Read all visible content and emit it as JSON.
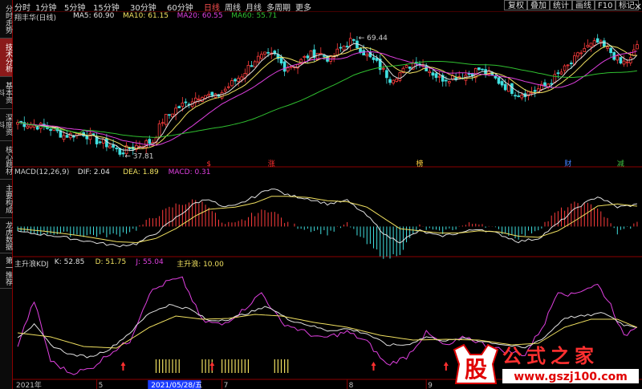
{
  "sidebar": {
    "items": [
      {
        "label": "分时走势",
        "active": false
      },
      {
        "label": "技术分析",
        "active": true
      },
      {
        "label": "基本资料",
        "active": false
      },
      {
        "label": "深度资料",
        "active": false
      },
      {
        "label": "核心题材",
        "active": false
      },
      {
        "label": "主要构成",
        "active": false
      },
      {
        "label": "龙虎数据",
        "active": false
      },
      {
        "label": "第一推荐",
        "active": false
      }
    ]
  },
  "topbar": {
    "periods": [
      {
        "label": "分时",
        "active": false
      },
      {
        "label": "1分钟",
        "active": false
      },
      {
        "label": "5分钟",
        "active": false
      },
      {
        "label": "15分钟",
        "active": false
      },
      {
        "label": "30分钟",
        "active": false
      },
      {
        "label": "60分钟",
        "active": false
      },
      {
        "label": "日线",
        "active": true
      },
      {
        "label": "周线",
        "active": false
      },
      {
        "label": "月线",
        "active": false
      },
      {
        "label": "多周期",
        "active": false
      },
      {
        "label": "更多",
        "active": false
      }
    ],
    "buttons": [
      "复权",
      "叠加",
      "统计",
      "画线",
      "F10",
      "标记"
    ],
    "close_symbol": "×"
  },
  "main_panel": {
    "stock_name": "翔丰华(日线)",
    "ma_legend": [
      {
        "label": "MA5: 60.90",
        "color": "#e0e0e0"
      },
      {
        "label": "MA10: 61.15",
        "color": "#f0e060"
      },
      {
        "label": "MA20: 60.55",
        "color": "#e040e0"
      },
      {
        "label": "MA60: 55.71",
        "color": "#30c030"
      }
    ],
    "high_label": "69.44",
    "low_label": "37.81",
    "markers": [
      {
        "text": "$",
        "color": "#ff3030",
        "idx": 58
      },
      {
        "text": "涨",
        "color": "#ff3030",
        "idx": 77
      },
      {
        "text": "榜",
        "color": "#ffd040",
        "idx": 122
      },
      {
        "text": "财",
        "color": "#4080ff",
        "idx": 167
      },
      {
        "text": "减",
        "color": "#40c040",
        "idx": 183
      }
    ]
  },
  "macd_panel": {
    "legend": [
      {
        "label": "MACD(12,26,9)",
        "color": "#d0d0d0"
      },
      {
        "label": "DIF: 2.04",
        "color": "#e0e0e0"
      },
      {
        "label": "DEA: 1.89",
        "color": "#f0e060"
      },
      {
        "label": "MACD: 0.31",
        "color": "#e040e0"
      }
    ]
  },
  "kdj_panel": {
    "legend": [
      {
        "label": "主升浪KDJ",
        "color": "#d0d0d0"
      },
      {
        "label": "K: 52.85",
        "color": "#e0e0e0"
      },
      {
        "label": "D: 51.75",
        "color": "#f0e060"
      },
      {
        "label": "J: 55.04",
        "color": "#e040e0"
      },
      {
        "label": "主升浪: 10.00",
        "color": "#f0e060"
      }
    ]
  },
  "date_axis": {
    "labels": [
      {
        "text": "2021年",
        "idx": 0,
        "highlight": false
      },
      {
        "text": "5",
        "idx": 24,
        "highlight": false
      },
      {
        "text": "2021/05/28/五",
        "idx": 40,
        "highlight": true
      },
      {
        "text": "7",
        "idx": 62,
        "highlight": false
      },
      {
        "text": "8",
        "idx": 100,
        "highlight": false
      },
      {
        "text": "9",
        "idx": 124,
        "highlight": false
      }
    ]
  },
  "logo": {
    "badge": "股",
    "name": "公式之家",
    "url": "www.gszj100.com"
  },
  "colors": {
    "up": "#ff3c3c",
    "down": "#40e0e0",
    "ma5": "#e0e0e0",
    "ma10": "#f0e060",
    "ma20": "#e040e0",
    "ma60": "#30c030",
    "grid": "#8b0000"
  },
  "chart_data": [
    {
      "type": "candlestick",
      "title": "翔丰华(日线)",
      "series": [
        {
          "name": "MA5",
          "value": 60.9
        },
        {
          "name": "MA10",
          "value": 61.15
        },
        {
          "name": "MA20",
          "value": 60.55
        },
        {
          "name": "MA60",
          "value": 55.71
        }
      ],
      "ohlc_points": [
        {
          "i": 0,
          "c": 46.5
        },
        {
          "i": 6,
          "c": 45.6
        },
        {
          "i": 10,
          "c": 44.8
        },
        {
          "i": 14,
          "c": 43.0
        },
        {
          "i": 20,
          "c": 43.6
        },
        {
          "i": 24,
          "c": 41.6
        },
        {
          "i": 28,
          "c": 40.4
        },
        {
          "i": 31,
          "c": 38.5
        },
        {
          "i": 36,
          "c": 40.3
        },
        {
          "i": 41,
          "c": 41.5
        },
        {
          "i": 44,
          "c": 47.0
        },
        {
          "i": 48,
          "c": 50.0
        },
        {
          "i": 52,
          "c": 52.0
        },
        {
          "i": 56,
          "c": 54.0
        },
        {
          "i": 60,
          "c": 53.0
        },
        {
          "i": 64,
          "c": 56.0
        },
        {
          "i": 68,
          "c": 59.0
        },
        {
          "i": 70,
          "c": 61.0
        },
        {
          "i": 72,
          "c": 63.0
        },
        {
          "i": 75,
          "c": 64.0
        },
        {
          "i": 78,
          "c": 64.0
        },
        {
          "i": 81,
          "c": 61.0
        },
        {
          "i": 85,
          "c": 62.0
        },
        {
          "i": 88,
          "c": 64.0
        },
        {
          "i": 91,
          "c": 65.0
        },
        {
          "i": 95,
          "c": 63.0
        },
        {
          "i": 98,
          "c": 66.0
        },
        {
          "i": 101,
          "c": 68.0
        },
        {
          "i": 104,
          "c": 66.0
        },
        {
          "i": 106,
          "c": 64.0
        },
        {
          "i": 109,
          "c": 62.0
        },
        {
          "i": 113,
          "c": 58.0
        },
        {
          "i": 117,
          "c": 60.0
        },
        {
          "i": 121,
          "c": 63.0
        },
        {
          "i": 124,
          "c": 61.0
        },
        {
          "i": 128,
          "c": 58.0
        },
        {
          "i": 132,
          "c": 58.5
        },
        {
          "i": 136,
          "c": 59.0
        },
        {
          "i": 140,
          "c": 60.5
        },
        {
          "i": 144,
          "c": 58.5
        },
        {
          "i": 148,
          "c": 56.0
        },
        {
          "i": 152,
          "c": 54.0
        },
        {
          "i": 156,
          "c": 54.5
        },
        {
          "i": 160,
          "c": 56.0
        },
        {
          "i": 164,
          "c": 59.0
        },
        {
          "i": 168,
          "c": 62.0
        },
        {
          "i": 172,
          "c": 66.0
        },
        {
          "i": 176,
          "c": 67.5
        },
        {
          "i": 180,
          "c": 65.0
        },
        {
          "i": 183,
          "c": 62.0
        },
        {
          "i": 186,
          "c": 63.0
        },
        {
          "i": 188,
          "c": 67.0
        }
      ],
      "n_bars": 189,
      "high": 69.44,
      "low": 37.81,
      "ylim": [
        36,
        72
      ]
    },
    {
      "type": "bar",
      "title": "MACD(12,26,9)",
      "series": [
        {
          "name": "DIF",
          "value": 2.04
        },
        {
          "name": "DEA",
          "value": 1.89
        },
        {
          "name": "MACD",
          "value": 0.31
        }
      ],
      "dif_points": [
        {
          "i": 0,
          "v": -0.5
        },
        {
          "i": 10,
          "v": -0.8
        },
        {
          "i": 20,
          "v": -1.3
        },
        {
          "i": 30,
          "v": -1.8
        },
        {
          "i": 36,
          "v": -1.6
        },
        {
          "i": 42,
          "v": -0.6
        },
        {
          "i": 48,
          "v": 0.8
        },
        {
          "i": 54,
          "v": 2.2
        },
        {
          "i": 58,
          "v": 2.6
        },
        {
          "i": 62,
          "v": 1.8
        },
        {
          "i": 66,
          "v": 1.9
        },
        {
          "i": 72,
          "v": 2.8
        },
        {
          "i": 77,
          "v": 3.6
        },
        {
          "i": 82,
          "v": 2.9
        },
        {
          "i": 88,
          "v": 2.6
        },
        {
          "i": 94,
          "v": 2.1
        },
        {
          "i": 100,
          "v": 2.4
        },
        {
          "i": 106,
          "v": 1.0
        },
        {
          "i": 112,
          "v": -0.9
        },
        {
          "i": 116,
          "v": -1.4
        },
        {
          "i": 122,
          "v": -0.4
        },
        {
          "i": 128,
          "v": -0.9
        },
        {
          "i": 134,
          "v": -0.6
        },
        {
          "i": 140,
          "v": -0.2
        },
        {
          "i": 146,
          "v": -0.7
        },
        {
          "i": 152,
          "v": -1.4
        },
        {
          "i": 158,
          "v": -1.1
        },
        {
          "i": 164,
          "v": 0.3
        },
        {
          "i": 170,
          "v": 1.8
        },
        {
          "i": 176,
          "v": 2.8
        },
        {
          "i": 182,
          "v": 1.8
        },
        {
          "i": 188,
          "v": 2.04
        }
      ],
      "dea_points": [
        {
          "i": 0,
          "v": -0.2
        },
        {
          "i": 10,
          "v": -0.5
        },
        {
          "i": 20,
          "v": -0.9
        },
        {
          "i": 30,
          "v": -1.4
        },
        {
          "i": 36,
          "v": -1.5
        },
        {
          "i": 42,
          "v": -1.1
        },
        {
          "i": 48,
          "v": -0.2
        },
        {
          "i": 54,
          "v": 1.0
        },
        {
          "i": 58,
          "v": 1.6
        },
        {
          "i": 62,
          "v": 1.7
        },
        {
          "i": 66,
          "v": 1.8
        },
        {
          "i": 72,
          "v": 2.2
        },
        {
          "i": 77,
          "v": 2.8
        },
        {
          "i": 82,
          "v": 2.8
        },
        {
          "i": 88,
          "v": 2.7
        },
        {
          "i": 94,
          "v": 2.4
        },
        {
          "i": 100,
          "v": 2.3
        },
        {
          "i": 106,
          "v": 1.8
        },
        {
          "i": 112,
          "v": 0.6
        },
        {
          "i": 116,
          "v": -0.2
        },
        {
          "i": 122,
          "v": -0.4
        },
        {
          "i": 128,
          "v": -0.6
        },
        {
          "i": 134,
          "v": -0.6
        },
        {
          "i": 140,
          "v": -0.4
        },
        {
          "i": 146,
          "v": -0.5
        },
        {
          "i": 152,
          "v": -0.9
        },
        {
          "i": 158,
          "v": -1.0
        },
        {
          "i": 164,
          "v": -0.4
        },
        {
          "i": 170,
          "v": 0.7
        },
        {
          "i": 176,
          "v": 1.9
        },
        {
          "i": 182,
          "v": 2.1
        },
        {
          "i": 188,
          "v": 1.89
        }
      ],
      "ylim": [
        -2.5,
        4.5
      ]
    },
    {
      "type": "line",
      "title": "主升浪KDJ",
      "series": [
        {
          "name": "K",
          "value": 52.85
        },
        {
          "name": "D",
          "value": 51.75
        },
        {
          "name": "J",
          "value": 55.04
        },
        {
          "name": "主升浪",
          "value": 10.0
        }
      ],
      "k_points": [
        {
          "i": 0,
          "v": 40
        },
        {
          "i": 5,
          "v": 55
        },
        {
          "i": 10,
          "v": 30
        },
        {
          "i": 16,
          "v": 18
        },
        {
          "i": 22,
          "v": 15
        },
        {
          "i": 28,
          "v": 25
        },
        {
          "i": 34,
          "v": 45
        },
        {
          "i": 40,
          "v": 70
        },
        {
          "i": 46,
          "v": 80
        },
        {
          "i": 52,
          "v": 75
        },
        {
          "i": 58,
          "v": 60
        },
        {
          "i": 64,
          "v": 62
        },
        {
          "i": 70,
          "v": 70
        },
        {
          "i": 76,
          "v": 78
        },
        {
          "i": 82,
          "v": 62
        },
        {
          "i": 88,
          "v": 55
        },
        {
          "i": 94,
          "v": 48
        },
        {
          "i": 100,
          "v": 50
        },
        {
          "i": 106,
          "v": 44
        },
        {
          "i": 112,
          "v": 30
        },
        {
          "i": 118,
          "v": 30
        },
        {
          "i": 124,
          "v": 40
        },
        {
          "i": 130,
          "v": 35
        },
        {
          "i": 136,
          "v": 38
        },
        {
          "i": 142,
          "v": 34
        },
        {
          "i": 148,
          "v": 30
        },
        {
          "i": 154,
          "v": 26
        },
        {
          "i": 160,
          "v": 40
        },
        {
          "i": 166,
          "v": 64
        },
        {
          "i": 172,
          "v": 66
        },
        {
          "i": 178,
          "v": 70
        },
        {
          "i": 184,
          "v": 55
        },
        {
          "i": 188,
          "v": 52.85
        }
      ],
      "d_points": [
        {
          "i": 0,
          "v": 45
        },
        {
          "i": 10,
          "v": 40
        },
        {
          "i": 20,
          "v": 28
        },
        {
          "i": 30,
          "v": 26
        },
        {
          "i": 40,
          "v": 52
        },
        {
          "i": 48,
          "v": 66
        },
        {
          "i": 56,
          "v": 62
        },
        {
          "i": 64,
          "v": 63
        },
        {
          "i": 72,
          "v": 68
        },
        {
          "i": 80,
          "v": 66
        },
        {
          "i": 90,
          "v": 58
        },
        {
          "i": 100,
          "v": 52
        },
        {
          "i": 110,
          "v": 42
        },
        {
          "i": 120,
          "v": 36
        },
        {
          "i": 130,
          "v": 37
        },
        {
          "i": 140,
          "v": 36
        },
        {
          "i": 150,
          "v": 30
        },
        {
          "i": 158,
          "v": 32
        },
        {
          "i": 166,
          "v": 52
        },
        {
          "i": 174,
          "v": 62
        },
        {
          "i": 182,
          "v": 62
        },
        {
          "i": 188,
          "v": 51.75
        }
      ],
      "j_points": [
        {
          "i": 0,
          "v": 30
        },
        {
          "i": 5,
          "v": 85
        },
        {
          "i": 10,
          "v": 10
        },
        {
          "i": 16,
          "v": -5
        },
        {
          "i": 22,
          "v": 0
        },
        {
          "i": 28,
          "v": 20
        },
        {
          "i": 34,
          "v": 35
        },
        {
          "i": 40,
          "v": 95
        },
        {
          "i": 46,
          "v": 110
        },
        {
          "i": 50,
          "v": 112
        },
        {
          "i": 56,
          "v": 60
        },
        {
          "i": 62,
          "v": 55
        },
        {
          "i": 68,
          "v": 72
        },
        {
          "i": 74,
          "v": 95
        },
        {
          "i": 80,
          "v": 58
        },
        {
          "i": 86,
          "v": 48
        },
        {
          "i": 92,
          "v": 38
        },
        {
          "i": 100,
          "v": 46
        },
        {
          "i": 106,
          "v": 34
        },
        {
          "i": 112,
          "v": 5
        },
        {
          "i": 118,
          "v": 15
        },
        {
          "i": 124,
          "v": 45
        },
        {
          "i": 130,
          "v": 28
        },
        {
          "i": 136,
          "v": 40
        },
        {
          "i": 142,
          "v": 30
        },
        {
          "i": 148,
          "v": 22
        },
        {
          "i": 154,
          "v": 18
        },
        {
          "i": 160,
          "v": 58
        },
        {
          "i": 164,
          "v": 98
        },
        {
          "i": 168,
          "v": 92
        },
        {
          "i": 172,
          "v": 100
        },
        {
          "i": 176,
          "v": 105
        },
        {
          "i": 180,
          "v": 80
        },
        {
          "i": 184,
          "v": 40
        },
        {
          "i": 188,
          "v": 55.04
        }
      ],
      "signal_clusters": [
        {
          "start": 42,
          "end": 49
        },
        {
          "start": 56,
          "end": 59
        },
        {
          "start": 62,
          "end": 70
        },
        {
          "start": 78,
          "end": 82
        }
      ],
      "arrow_idx": [
        32,
        59,
        108,
        130
      ],
      "ylim": [
        -10,
        120
      ]
    }
  ]
}
